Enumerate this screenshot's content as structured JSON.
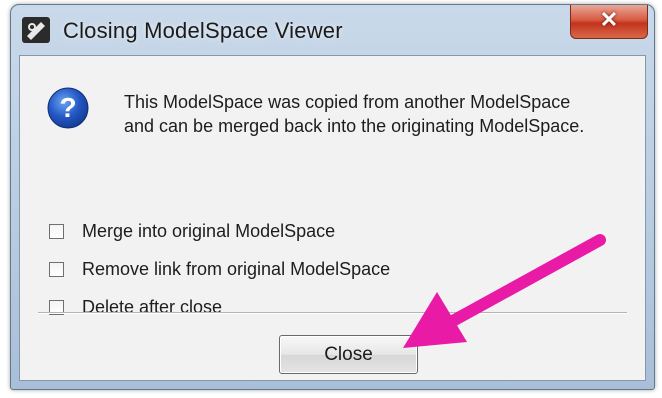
{
  "dialog": {
    "title": "Closing ModelSpace Viewer",
    "close_glyph": "✕",
    "message_line1": "This ModelSpace was copied from another ModelSpace",
    "message_line2": "and can be merged back into the originating ModelSpace.",
    "options": [
      {
        "label": "Merge into original ModelSpace",
        "checked": false
      },
      {
        "label": "Remove link from original ModelSpace",
        "checked": false
      },
      {
        "label": "Delete after close",
        "checked": false
      }
    ],
    "close_button_label": "Close"
  },
  "icons": {
    "app": "modelspace-app-icon",
    "info": "question-icon",
    "annotation": "magenta-arrow"
  },
  "colors": {
    "annotation_arrow": "#e81aa6",
    "info_blue": "#1b4fb8"
  }
}
